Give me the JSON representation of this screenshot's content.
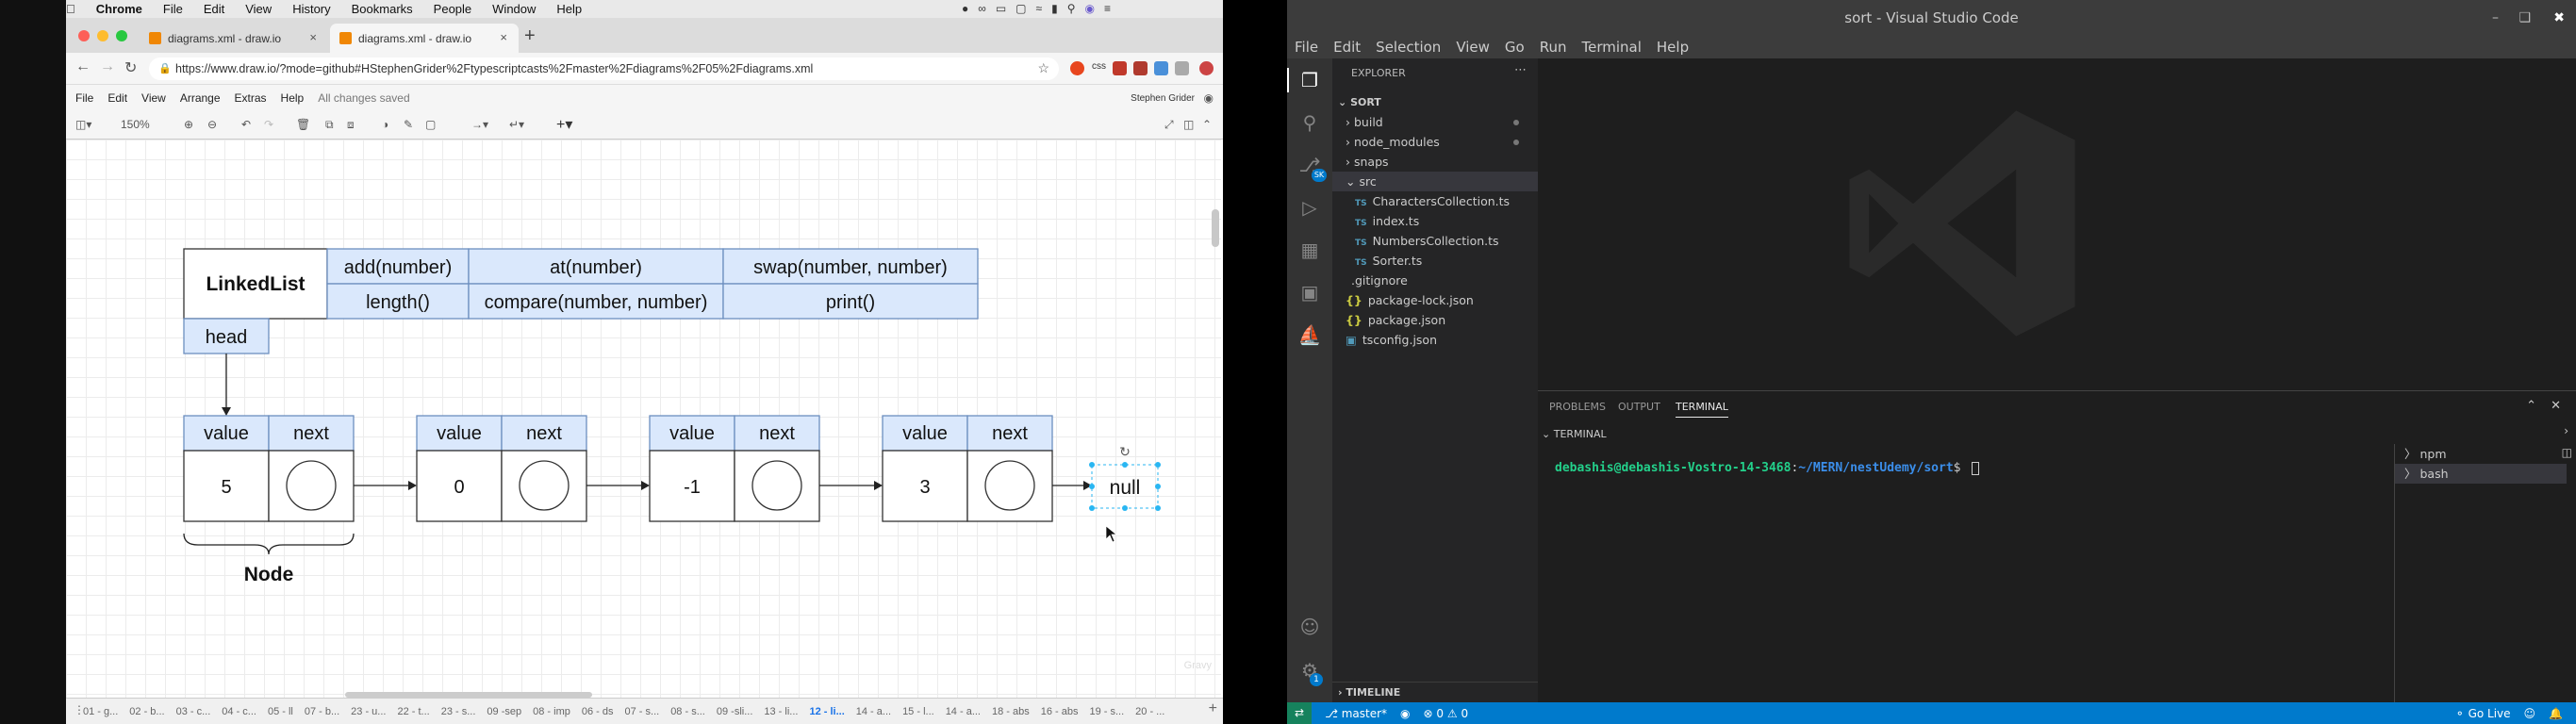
{
  "mac_menu": {
    "apple_icon": "apple-icon",
    "app": "Chrome",
    "items": [
      "File",
      "Edit",
      "View",
      "History",
      "Bookmarks",
      "People",
      "Window",
      "Help"
    ]
  },
  "browser": {
    "tabs": [
      {
        "title": "diagrams.xml - draw.io",
        "active": false
      },
      {
        "title": "diagrams.xml - draw.io",
        "active": true
      }
    ],
    "url": "https://www.draw.io/?mode=github#HStephenGrider%2Ftypescriptcasts%2Fmaster%2Fdiagrams%2F05%2Fdiagrams.xml",
    "ext_label": "css"
  },
  "drawio": {
    "menu": [
      "File",
      "Edit",
      "View",
      "Arrange",
      "Extras",
      "Help"
    ],
    "saved_status": "All changes saved",
    "user": "Stephen Grider",
    "zoom": "150%",
    "diagram": {
      "title": "LinkedList",
      "methods_row1": [
        "add(number)",
        "at(number)",
        "swap(number, number)"
      ],
      "methods_row2": [
        "length()",
        "compare(number, number)",
        "print()"
      ],
      "head": "head",
      "node_header": [
        "value",
        "next"
      ],
      "nodes": [
        "5",
        "0",
        "-1",
        "3"
      ],
      "null_label": "null",
      "brace_label": "Node",
      "watermark": "Gravy"
    },
    "page_tabs": [
      "01 - g...",
      "02 - b...",
      "03 - c...",
      "04 - c...",
      "05 - ll",
      "07 - b...",
      "23 - u...",
      "22 - t...",
      "23 - s...",
      "09 -sep",
      "08 - imp",
      "06 - ds",
      "07 - s...",
      "08 - s...",
      "09 -sli...",
      "13 - li...",
      "12 - li...",
      "14 - a...",
      "15 - l...",
      "14 - a...",
      "18 - abs",
      "16 - abs",
      "19 - s...",
      "20 - ..."
    ],
    "active_page_index": 16
  },
  "vscode": {
    "title": "sort - Visual Studio Code",
    "menu": [
      "File",
      "Edit",
      "Selection",
      "View",
      "Go",
      "Run",
      "Terminal",
      "Help"
    ],
    "explorer_label": "EXPLORER",
    "root_folder": "SORT",
    "tree": [
      {
        "label": "build",
        "kind": "folder",
        "depth": 1,
        "dot": true
      },
      {
        "label": "node_modules",
        "kind": "folder",
        "depth": 1,
        "dot": true
      },
      {
        "label": "snaps",
        "kind": "folder",
        "depth": 1,
        "dot": false
      },
      {
        "label": "src",
        "kind": "folder-open",
        "depth": 1,
        "dot": false,
        "selected": true
      },
      {
        "label": "CharactersCollection.ts",
        "kind": "ts",
        "depth": 2
      },
      {
        "label": "index.ts",
        "kind": "ts",
        "depth": 2
      },
      {
        "label": "NumbersCollection.ts",
        "kind": "ts",
        "depth": 2
      },
      {
        "label": "Sorter.ts",
        "kind": "ts",
        "depth": 2
      },
      {
        "label": ".gitignore",
        "kind": "git",
        "depth": 1
      },
      {
        "label": "package-lock.json",
        "kind": "json",
        "depth": 1
      },
      {
        "label": "package.json",
        "kind": "json",
        "depth": 1
      },
      {
        "label": "tsconfig.json",
        "kind": "tsconfig",
        "depth": 1
      }
    ],
    "type_badge": "TS",
    "json_badge": "{}",
    "timeline_label": "TIMELINE",
    "account_badge": "SK",
    "settings_badge": "1",
    "panel_tabs": [
      "PROBLEMS",
      "OUTPUT",
      "TERMINAL"
    ],
    "active_panel_tab": "TERMINAL",
    "terminal_header": "TERMINAL",
    "prompt_user": "debashis@debashis-Vostro-14-3468",
    "prompt_path": "~/MERN/nestUdemy/sort",
    "prompt_sym": "$",
    "terminals": [
      "npm",
      "bash"
    ],
    "status": {
      "branch": "master*",
      "errors": "0",
      "warnings": "0",
      "golive": "Go Live"
    },
    "colors": {
      "statusbar": "#007acc",
      "terminal_user": "#23d18b",
      "terminal_path": "#3b8eea"
    }
  }
}
